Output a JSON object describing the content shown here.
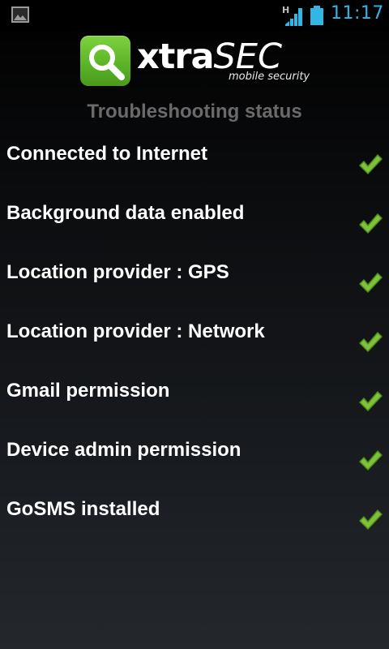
{
  "status_bar": {
    "time": "11:17",
    "network_type": "H",
    "clock_color": "#33b5e5",
    "icons": [
      "picture-notification-icon",
      "signal-strength-icon",
      "battery-icon"
    ]
  },
  "header": {
    "logo_word_bold": "xtra",
    "logo_word_light": "SEC",
    "logo_subtitle": "mobile security",
    "brand_color": "#5db528"
  },
  "page_title": "Troubleshooting status",
  "checks": [
    {
      "label": "Connected to Internet",
      "status": "ok",
      "icon": "green-checkmark-icon"
    },
    {
      "label": "Background data enabled",
      "status": "ok",
      "icon": "green-checkmark-icon"
    },
    {
      "label": "Location provider : GPS",
      "status": "ok",
      "icon": "green-checkmark-icon"
    },
    {
      "label": "Location provider : Network",
      "status": "ok",
      "icon": "green-checkmark-icon"
    },
    {
      "label": "Gmail permission",
      "status": "ok",
      "icon": "green-checkmark-icon"
    },
    {
      "label": "Device admin permission",
      "status": "ok",
      "icon": "green-checkmark-icon"
    },
    {
      "label": "GoSMS installed",
      "status": "ok",
      "icon": "green-checkmark-icon"
    }
  ]
}
